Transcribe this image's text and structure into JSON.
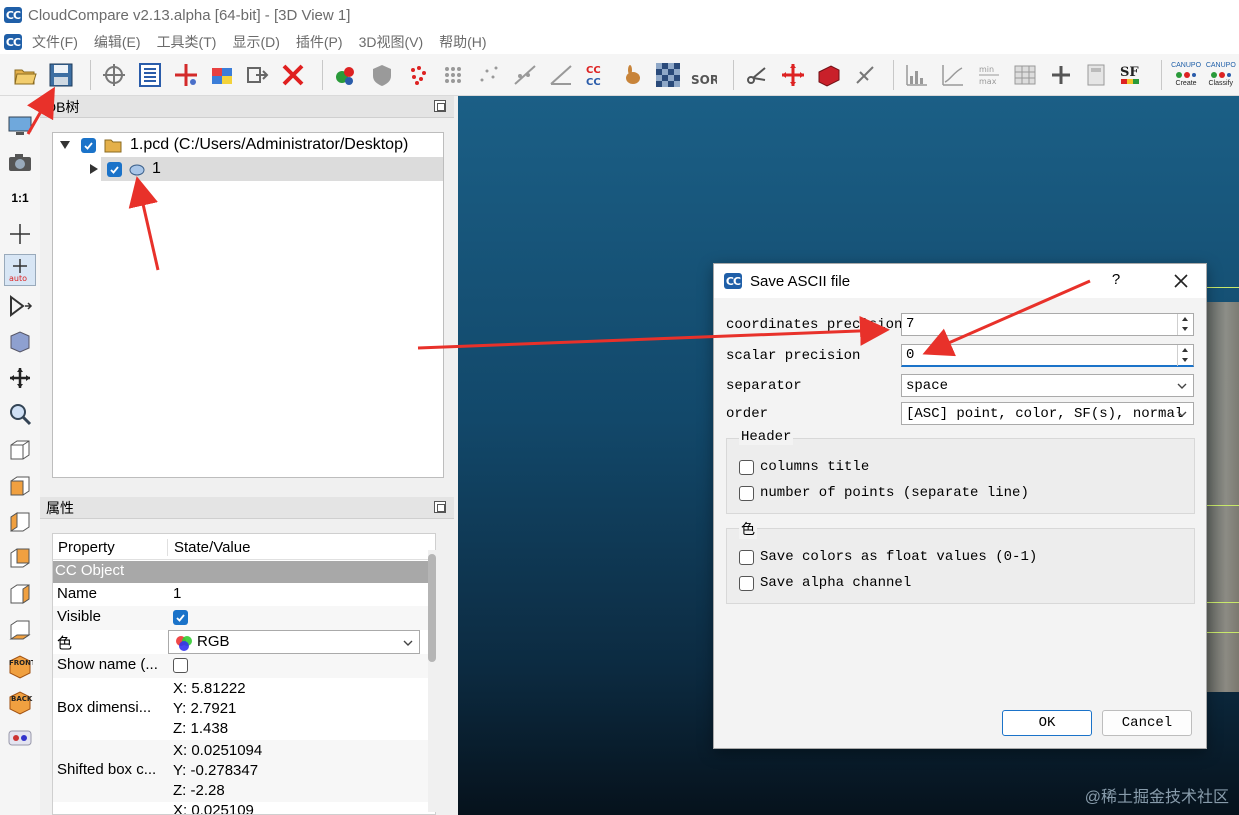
{
  "window": {
    "title": "CloudCompare v2.13.alpha [64-bit] - [3D View 1]",
    "logo": "CC"
  },
  "menu": [
    "文件(F)",
    "编辑(E)",
    "工具类(T)",
    "显示(D)",
    "插件(P)",
    "3D视图(V)",
    "帮助(H)"
  ],
  "toolbar": {
    "icons": [
      "open-icon",
      "save-icon",
      "clone-icon",
      "list-icon",
      "sample-icon",
      "color-cube-icon",
      "export-icon",
      "delete-icon"
    ],
    "sor_label": "SOR",
    "sf_label": "SF",
    "ccc_label": "CC",
    "minmax_label_top": "min",
    "minmax_label_bottom": "max",
    "canupo_create_top": "CANUPO",
    "canupo_create_bottom": "Create",
    "canupo_classify_top": "CANUPO",
    "canupo_classify_bottom": "Classify"
  },
  "left_toolbar": {
    "one_to_one": "1:1",
    "auto_label": "auto",
    "front_label": "FRONT",
    "back_label": "BACK"
  },
  "db_panel": {
    "title": "DB树",
    "items": [
      {
        "label": "1.pcd (C:/Users/Administrator/Desktop)",
        "checked": true,
        "expanded": true
      },
      {
        "label": "1",
        "checked": true,
        "selected": true
      }
    ]
  },
  "properties_panel": {
    "title": "属性",
    "headers": [
      "Property",
      "State/Value"
    ],
    "section": "CC Object",
    "rows": {
      "name": {
        "key": "Name",
        "value": "1"
      },
      "visible": {
        "key": "Visible",
        "checked": true
      },
      "color": {
        "key": "色",
        "value": "RGB"
      },
      "show_name": {
        "key": "Show name (...",
        "checked": false
      },
      "box": {
        "key": "Box dimensi...",
        "x": "X: 5.81222",
        "y": "Y: 2.7921",
        "z": "Z: 1.438"
      },
      "shifted": {
        "key": "Shifted box c...",
        "x": "X: 0.0251094",
        "y": "Y: -0.278347",
        "z": "Z: -2.28"
      },
      "partial_x": "X: 0.025109"
    }
  },
  "dialog": {
    "title": "Save ASCII file",
    "help": "?",
    "fields": {
      "coord_precision": {
        "label": "coordinates precision",
        "value": "7"
      },
      "scalar_precision": {
        "label": "scalar precision",
        "value": "0"
      },
      "separator": {
        "label": "separator",
        "value": "space"
      },
      "order": {
        "label": "order",
        "value": "[ASC] point, color, SF(s), normal"
      }
    },
    "header_group": {
      "title": "Header",
      "columns_title": {
        "label": "columns title",
        "checked": false
      },
      "number_of_points": {
        "label": "number of points (separate line)",
        "checked": false
      }
    },
    "color_group": {
      "title": "色",
      "save_float": {
        "label": "Save colors as float values (0-1)",
        "checked": false
      },
      "save_alpha": {
        "label": "Save alpha channel",
        "checked": false
      }
    },
    "ok": "OK",
    "cancel": "Cancel"
  },
  "watermark": "@稀土掘金技术社区",
  "colors": {
    "accent": "#1b73c9",
    "annotation": "#e8312a",
    "view_bg": "#12486a"
  }
}
